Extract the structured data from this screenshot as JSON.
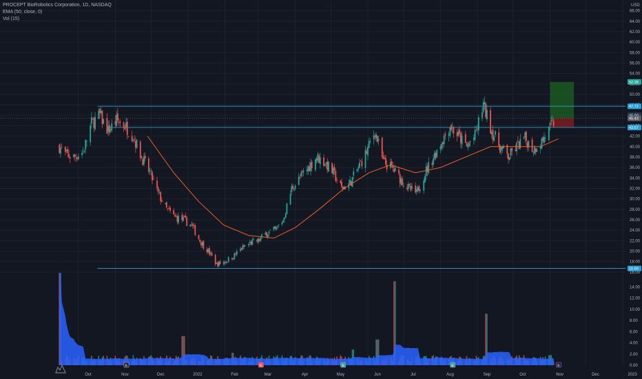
{
  "legend": {
    "symbol_line": "PROCEPT BioRobotics Corporation, 1D, NASDAQ",
    "ema_line": "EMA (50, close, 0)",
    "vol_line": "Vol (15)"
  },
  "colors": {
    "background": "#131722",
    "up": "#26a69a",
    "down": "#ef5350",
    "ema": "#f0602a",
    "level_line": "#2a9fd8",
    "volume_ma": "#2962ff",
    "target_zone": "#1b5e20",
    "stop_zone": "#7f1d1d"
  },
  "chart_data": {
    "type": "candlestick",
    "price_axis": {
      "unit": "USD",
      "ylim": [
        14,
        67
      ],
      "ticks": [
        "66.00",
        "64.00",
        "62.00",
        "60.00",
        "58.00",
        "56.00",
        "54.00",
        "52.00",
        "50.00",
        "48.00",
        "46.00",
        "44.00",
        "42.00",
        "40.00",
        "38.00",
        "36.00",
        "34.00",
        "32.00",
        "30.00",
        "28.00",
        "26.00",
        "24.00",
        "22.00",
        "20.00",
        "18.00",
        "16.00"
      ],
      "tick_values": [
        66,
        64,
        62,
        60,
        58,
        56,
        54,
        52,
        50,
        48,
        46,
        44,
        42,
        40,
        38,
        36,
        34,
        32,
        30,
        28,
        26,
        24,
        22,
        20,
        18,
        16
      ]
    },
    "volume_axis": {
      "ylim": [
        0,
        16
      ],
      "ticks": [
        "14.00",
        "12.00",
        "10.00",
        "8.00",
        "6.00",
        "4.00",
        "2.00",
        "0.00"
      ],
      "tick_values": [
        14,
        12,
        10,
        8,
        6,
        4,
        2,
        0
      ]
    },
    "time_axis": {
      "labels": [
        "Oct",
        "Nov",
        "Dec",
        "2022",
        "Feb",
        "Mar",
        "Apr",
        "May",
        "Jun",
        "Jul",
        "Aug",
        "Sep",
        "Oct",
        "Nov",
        "Dec",
        "2023"
      ],
      "positions": [
        "2021-10-01",
        "2021-11-01",
        "2021-12-01",
        "2022-01-01",
        "2022-02-01",
        "2022-03-01",
        "2022-04-01",
        "2022-05-01",
        "2022-06-01",
        "2022-07-01",
        "2022-08-01",
        "2022-09-01",
        "2022-10-01",
        "2022-11-01",
        "2022-12-01",
        "2023-01-01"
      ]
    },
    "price_path": [
      [
        "2021-09-15",
        40.0
      ],
      [
        "2021-09-20",
        38.5
      ],
      [
        "2021-09-27",
        38.0
      ],
      [
        "2021-10-05",
        39.0
      ],
      [
        "2021-10-12",
        44.5
      ],
      [
        "2021-10-19",
        46.0
      ],
      [
        "2021-10-26",
        43.0
      ],
      [
        "2021-11-02",
        45.0
      ],
      [
        "2021-11-09",
        44.0
      ],
      [
        "2021-11-16",
        42.0
      ],
      [
        "2021-11-23",
        38.0
      ],
      [
        "2021-11-30",
        35.0
      ],
      [
        "2021-12-07",
        31.0
      ],
      [
        "2021-12-14",
        28.0
      ],
      [
        "2021-12-21",
        26.5
      ],
      [
        "2021-12-28",
        26.0
      ],
      [
        "2022-01-04",
        25.0
      ],
      [
        "2022-01-11",
        22.0
      ],
      [
        "2022-01-18",
        20.0
      ],
      [
        "2022-01-25",
        17.5
      ],
      [
        "2022-02-01",
        18.0
      ],
      [
        "2022-02-08",
        19.0
      ],
      [
        "2022-02-15",
        20.5
      ],
      [
        "2022-02-22",
        21.5
      ],
      [
        "2022-03-01",
        22.0
      ],
      [
        "2022-03-08",
        23.5
      ],
      [
        "2022-03-15",
        24.0
      ],
      [
        "2022-03-22",
        26.0
      ],
      [
        "2022-03-29",
        32.0
      ],
      [
        "2022-04-05",
        34.0
      ],
      [
        "2022-04-12",
        36.0
      ],
      [
        "2022-04-19",
        38.0
      ],
      [
        "2022-04-26",
        37.0
      ],
      [
        "2022-05-03",
        35.0
      ],
      [
        "2022-05-10",
        32.0
      ],
      [
        "2022-05-17",
        33.0
      ],
      [
        "2022-05-24",
        36.0
      ],
      [
        "2022-05-31",
        39.0
      ],
      [
        "2022-06-07",
        43.0
      ],
      [
        "2022-06-14",
        37.0
      ],
      [
        "2022-06-21",
        36.0
      ],
      [
        "2022-06-28",
        34.0
      ],
      [
        "2022-07-05",
        32.0
      ],
      [
        "2022-07-12",
        31.0
      ],
      [
        "2022-07-19",
        35.0
      ],
      [
        "2022-07-26",
        38.0
      ],
      [
        "2022-08-02",
        41.0
      ],
      [
        "2022-08-09",
        44.0
      ],
      [
        "2022-08-16",
        42.0
      ],
      [
        "2022-08-23",
        40.0
      ],
      [
        "2022-08-30",
        42.0
      ],
      [
        "2022-09-06",
        48.0
      ],
      [
        "2022-09-13",
        43.0
      ],
      [
        "2022-09-20",
        40.0
      ],
      [
        "2022-09-27",
        38.0
      ],
      [
        "2022-10-04",
        40.0
      ],
      [
        "2022-10-11",
        41.5
      ],
      [
        "2022-10-18",
        39.5
      ],
      [
        "2022-10-25",
        41.0
      ],
      [
        "2022-11-01",
        43.5
      ],
      [
        "2022-11-04",
        44.5
      ]
    ],
    "ema": {
      "name": "EMA (50, close, 0)",
      "points": [
        [
          "2021-11-28",
          42.0
        ],
        [
          "2021-12-20",
          35.0
        ],
        [
          "2022-01-10",
          29.5
        ],
        [
          "2022-01-31",
          25.0
        ],
        [
          "2022-02-21",
          23.0
        ],
        [
          "2022-03-14",
          22.5
        ],
        [
          "2022-04-01",
          24.5
        ],
        [
          "2022-04-21",
          28.0
        ],
        [
          "2022-05-12",
          32.0
        ],
        [
          "2022-06-02",
          35.0
        ],
        [
          "2022-06-20",
          36.5
        ],
        [
          "2022-07-11",
          35.0
        ],
        [
          "2022-08-01",
          36.0
        ],
        [
          "2022-08-22",
          38.0
        ],
        [
          "2022-09-12",
          40.0
        ],
        [
          "2022-10-03",
          40.0
        ],
        [
          "2022-10-24",
          40.0
        ],
        [
          "2022-11-08",
          41.5
        ]
      ]
    },
    "horizontal_levels": [
      {
        "start": "2021-10-17",
        "value": 47.72,
        "label": "47.72"
      },
      {
        "start": "2021-10-26",
        "value": 43.67,
        "label": "43.67"
      },
      {
        "start": "2021-10-17",
        "value": 16.69,
        "label": "16.69"
      }
    ],
    "price_labels": [
      {
        "value": 52.38,
        "label": "52.38",
        "style": "target"
      },
      {
        "value": 46.0,
        "label": "46.00",
        "style": "up"
      },
      {
        "value": 45.43,
        "label": "45.43",
        "style": "current"
      }
    ],
    "position_tool": {
      "start": "2022-11-01",
      "end": "2022-11-21",
      "entry": 45.43,
      "target": 52.38,
      "stop": 43.67
    },
    "volume_ma_name": "Vol (15)",
    "volume_peaks": [
      [
        "2021-09-15",
        16.5
      ],
      [
        "2021-12-28",
        5.2
      ],
      [
        "2022-02-07",
        2.2
      ],
      [
        "2022-05-20",
        2.8
      ],
      [
        "2022-06-09",
        4.6
      ],
      [
        "2022-06-24",
        15.0
      ],
      [
        "2022-09-09",
        9.2
      ],
      [
        "2022-11-01",
        1.8
      ]
    ],
    "event_markers": [
      {
        "date": "2021-11-10",
        "glyph": "E",
        "kind": "earnings"
      },
      {
        "date": "2022-03-03",
        "glyph": "E",
        "kind": "earnings-red"
      },
      {
        "date": "2022-05-11",
        "glyph": "E",
        "kind": "earnings"
      },
      {
        "date": "2022-08-11",
        "glyph": "E",
        "kind": "earnings"
      },
      {
        "date": "2022-11-08",
        "glyph": "E",
        "kind": "earnings-upcoming"
      }
    ]
  }
}
